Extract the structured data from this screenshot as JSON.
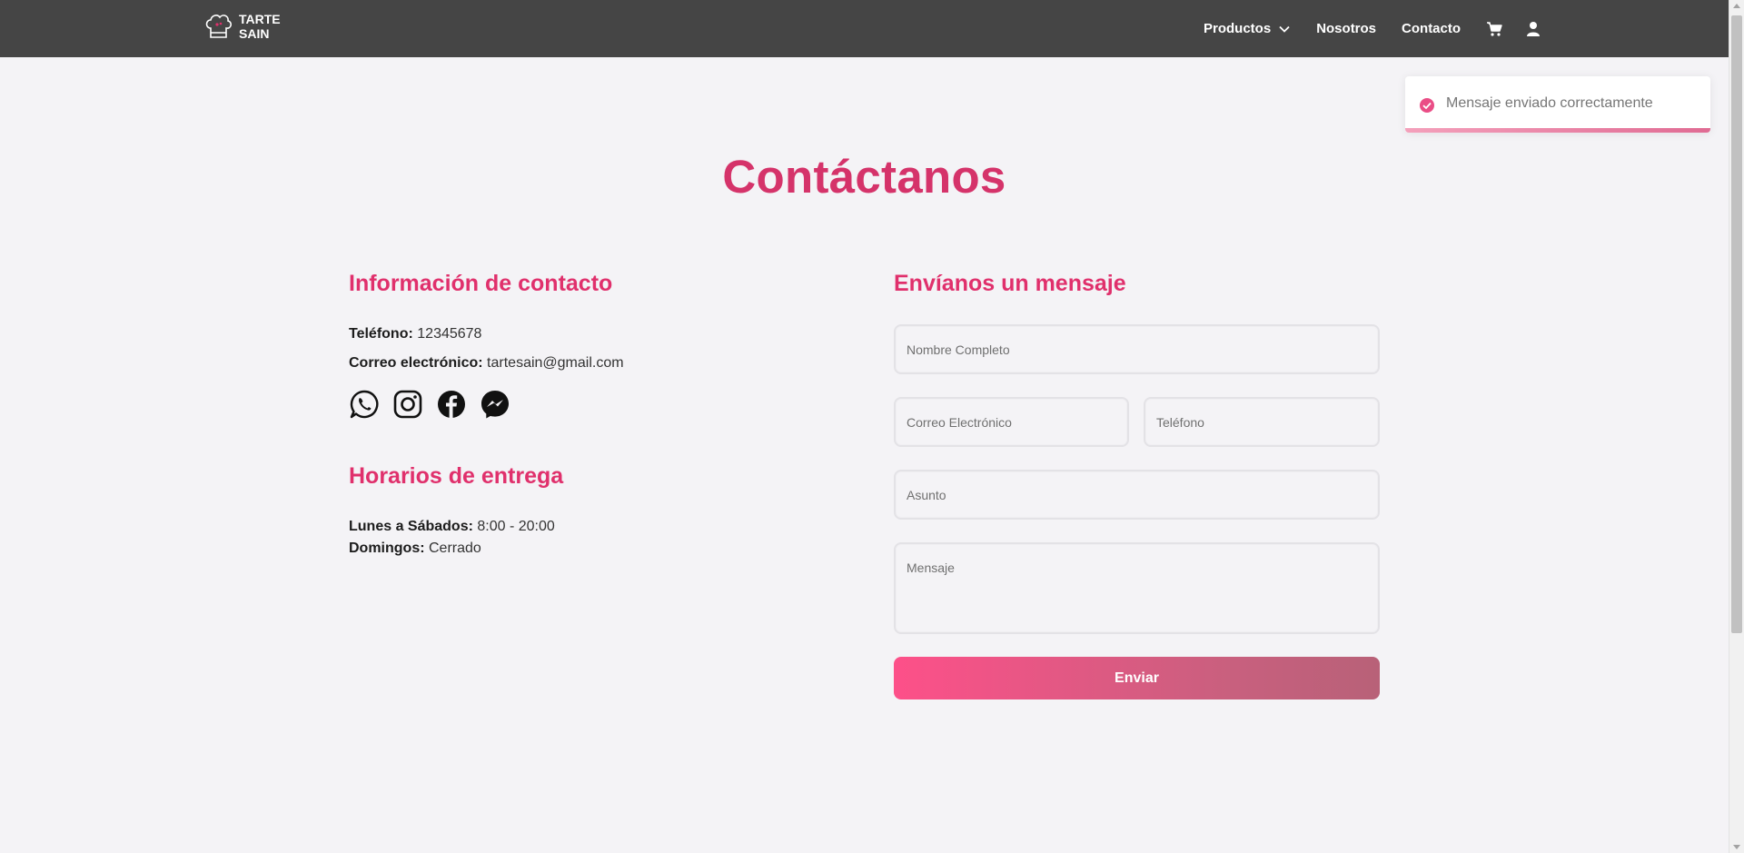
{
  "brand": {
    "line1": "TARTE",
    "line2": "SAIN"
  },
  "nav": {
    "products": "Productos",
    "about": "Nosotros",
    "contact": "Contacto"
  },
  "toast": {
    "message": "Mensaje enviado correctamente"
  },
  "page": {
    "title": "Contáctanos"
  },
  "contact_info": {
    "heading": "Información de contacto",
    "phone_label": "Teléfono:",
    "phone_value": "12345678",
    "email_label": "Correo electrónico:",
    "email_value": "tartesain@gmail.com"
  },
  "schedule": {
    "heading": "Horarios de entrega",
    "weekdays_label": "Lunes a Sábados:",
    "weekdays_value": "8:00 - 20:00",
    "sunday_label": "Domingos:",
    "sunday_value": "Cerrado"
  },
  "form": {
    "heading": "Envíanos un mensaje",
    "name_placeholder": "Nombre Completo",
    "email_placeholder": "Correo Electrónico",
    "phone_placeholder": "Teléfono",
    "subject_placeholder": "Asunto",
    "message_placeholder": "Mensaje",
    "submit_label": "Enviar"
  },
  "icons": [
    "chef-hat-icon",
    "chevron-down-icon",
    "cart-icon",
    "user-icon",
    "whatsapp-icon",
    "instagram-icon",
    "facebook-icon",
    "messenger-icon",
    "check-circle-icon"
  ],
  "colors": {
    "accent": "#e0306c",
    "navbar": "#454545",
    "background": "#f4f3f6"
  }
}
